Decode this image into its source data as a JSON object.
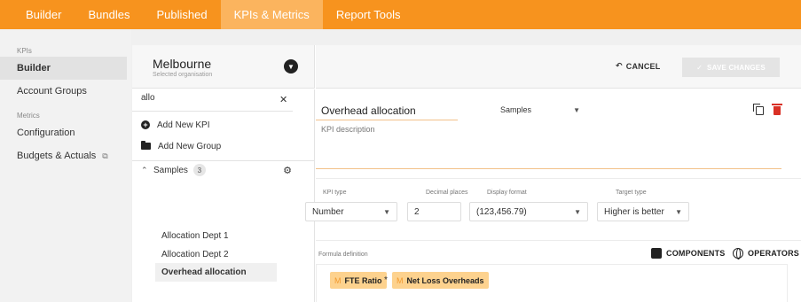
{
  "topnav": {
    "tabs": [
      {
        "label": "Builder"
      },
      {
        "label": "Bundles"
      },
      {
        "label": "Published"
      },
      {
        "label": "KPIs & Metrics"
      },
      {
        "label": "Report Tools"
      }
    ],
    "active": "KPIs & Metrics"
  },
  "leftnav": {
    "kpis_section": "KPIs",
    "kpis_items": [
      {
        "label": "Builder"
      },
      {
        "label": "Account Groups"
      }
    ],
    "metrics_section": "Metrics",
    "metrics_items": [
      {
        "label": "Configuration"
      },
      {
        "label": "Budgets & Actuals"
      }
    ]
  },
  "org": {
    "name": "Melbourne",
    "subtitle": "Selected organisation"
  },
  "actions": {
    "cancel": "CANCEL",
    "save": "SAVE CHANGES"
  },
  "tree": {
    "search_value": "allo",
    "add_kpi": "Add New KPI",
    "add_group": "Add New Group",
    "group_name": "Samples",
    "group_count": "3",
    "items": [
      {
        "label": "Allocation Dept 1"
      },
      {
        "label": "Allocation Dept 2"
      },
      {
        "label": "Overhead allocation"
      }
    ]
  },
  "editor": {
    "kpi_name": "Overhead allocation",
    "group_select": "Samples",
    "description_placeholder": "KPI description",
    "fields": {
      "kpi_type_label": "KPI type",
      "kpi_type_value": "Number",
      "decimal_label": "Decimal places",
      "decimal_value": "2",
      "display_label": "Display format",
      "display_value": "(123,456.79)",
      "target_label": "Target type",
      "target_value": "Higher is better"
    },
    "formula_label": "Formula definition",
    "components_label": "COMPONENTS",
    "operators_label": "OPERATORS",
    "formula": {
      "chip1_prefix": "M",
      "chip1_label": "FTE Ratio",
      "operator": "*",
      "chip2_prefix": "M",
      "chip2_label": "Net Loss Overheads"
    }
  },
  "colors": {
    "accent": "#f7931e",
    "active_tab": "#fbb45e",
    "chip": "#fdd28e",
    "delete": "#d93025"
  }
}
